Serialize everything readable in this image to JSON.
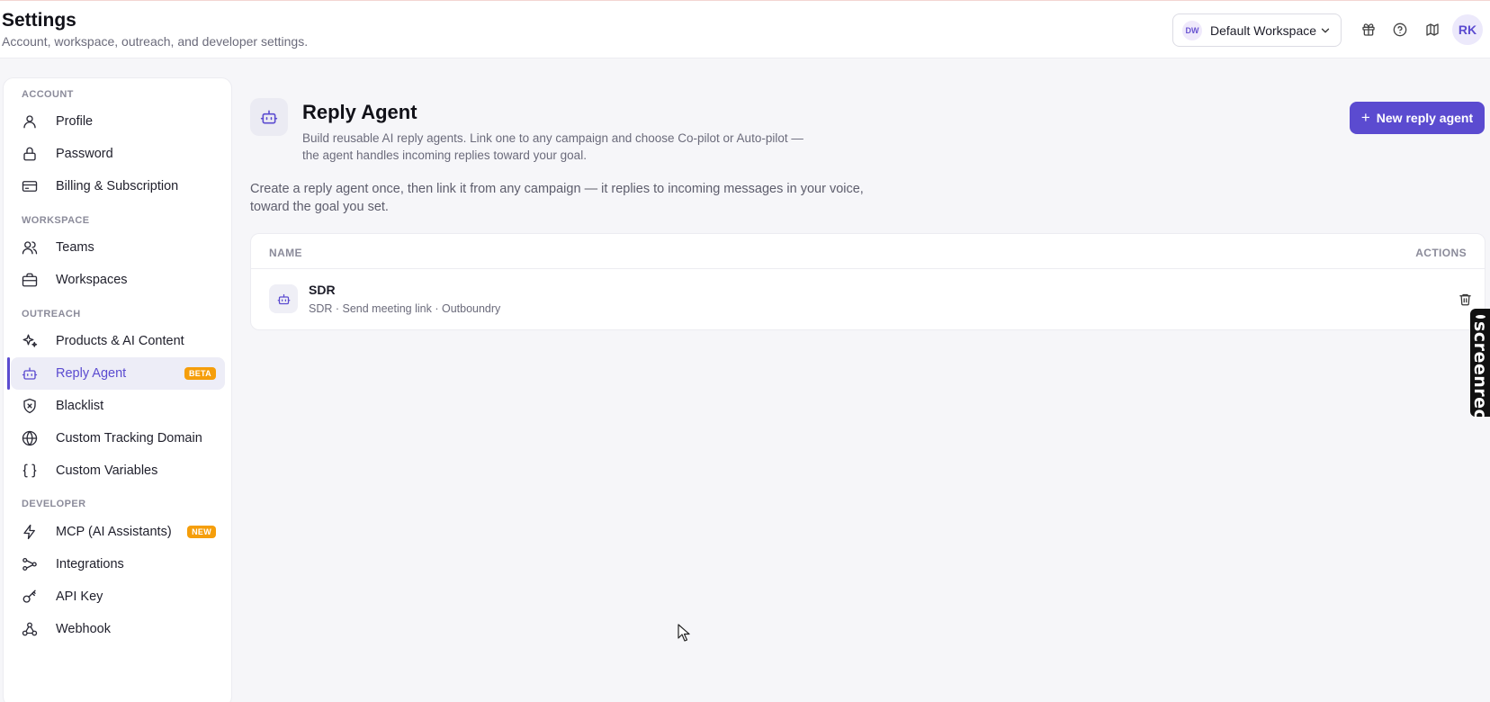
{
  "header": {
    "title": "Settings",
    "subtitle": "Account, workspace, outreach, and developer settings.",
    "workspace_badge": "DW",
    "workspace_name": "Default Workspace",
    "avatar_initials": "RK",
    "icons": [
      "gift-icon",
      "help-icon",
      "map-icon"
    ]
  },
  "sidebar": {
    "sections": [
      {
        "label": "ACCOUNT",
        "items": [
          {
            "label": "Profile",
            "icon": "user-icon"
          },
          {
            "label": "Password",
            "icon": "lock-icon"
          },
          {
            "label": "Billing & Subscription",
            "icon": "credit-card-icon"
          }
        ]
      },
      {
        "label": "WORKSPACE",
        "items": [
          {
            "label": "Teams",
            "icon": "users-icon"
          },
          {
            "label": "Workspaces",
            "icon": "briefcase-icon"
          }
        ]
      },
      {
        "label": "OUTREACH",
        "items": [
          {
            "label": "Products & AI Content",
            "icon": "sparkles-icon"
          },
          {
            "label": "Reply Agent",
            "icon": "bot-icon",
            "tag": "BETA",
            "active": true
          },
          {
            "label": "Blacklist",
            "icon": "shield-x-icon"
          },
          {
            "label": "Custom Tracking Domain",
            "icon": "globe-icon"
          },
          {
            "label": "Custom Variables",
            "icon": "braces-icon"
          }
        ]
      },
      {
        "label": "DEVELOPER",
        "items": [
          {
            "label": "MCP (AI Assistants)",
            "icon": "zap-icon",
            "tag": "NEW"
          },
          {
            "label": "Integrations",
            "icon": "workflow-icon"
          },
          {
            "label": "API Key",
            "icon": "key-icon"
          },
          {
            "label": "Webhook",
            "icon": "webhook-icon"
          }
        ]
      }
    ]
  },
  "main": {
    "title": "Reply Agent",
    "description": "Build reusable AI reply agents. Link one to any campaign and choose Co-pilot or Auto-pilot — the agent handles incoming replies toward your goal.",
    "new_button_label": "New reply agent",
    "intro": "Create a reply agent once, then link it from any campaign — it replies to incoming messages in your voice, toward the goal you set.",
    "table": {
      "columns": [
        "NAME",
        "ACTIONS"
      ],
      "rows": [
        {
          "name": "SDR",
          "meta": "SDR · Send meeting link · Outboundry"
        }
      ]
    }
  },
  "overlay": {
    "screenrec_label": "screenrec"
  },
  "colors": {
    "accent": "#5b4bd0",
    "tag": "#f59e0b"
  }
}
